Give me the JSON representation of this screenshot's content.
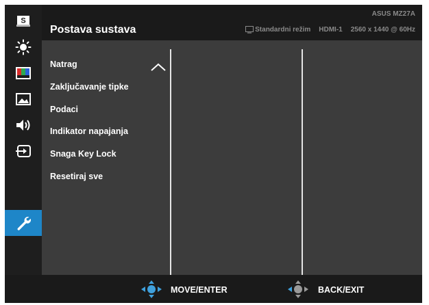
{
  "header": {
    "title": "Postava sustava",
    "model": "ASUS MZ27A",
    "mode": "Standardni režim",
    "input": "HDMI-1",
    "resolution": "2560 x 1440 @ 60Hz"
  },
  "sidebar": {
    "items": [
      {
        "name": "splendid-icon",
        "label": "S"
      },
      {
        "name": "brightness-icon"
      },
      {
        "name": "color-icon"
      },
      {
        "name": "image-icon"
      },
      {
        "name": "sound-icon"
      },
      {
        "name": "input-select-icon"
      },
      {
        "name": "system-setup-icon",
        "active": true
      }
    ]
  },
  "menu": {
    "items": [
      {
        "label": "Natrag"
      },
      {
        "label": "Zaključavanje tipke"
      },
      {
        "label": "Podaci"
      },
      {
        "label": "Indikator napajanja"
      },
      {
        "label": "Snaga Key Lock"
      },
      {
        "label": "Resetiraj sve"
      }
    ]
  },
  "footer": {
    "move_label": "MOVE/ENTER",
    "back_label": "BACK/EXIT"
  },
  "colors": {
    "accent": "#1e86c8",
    "panel": "#3c3c3c",
    "frame": "#1a1a1a"
  }
}
